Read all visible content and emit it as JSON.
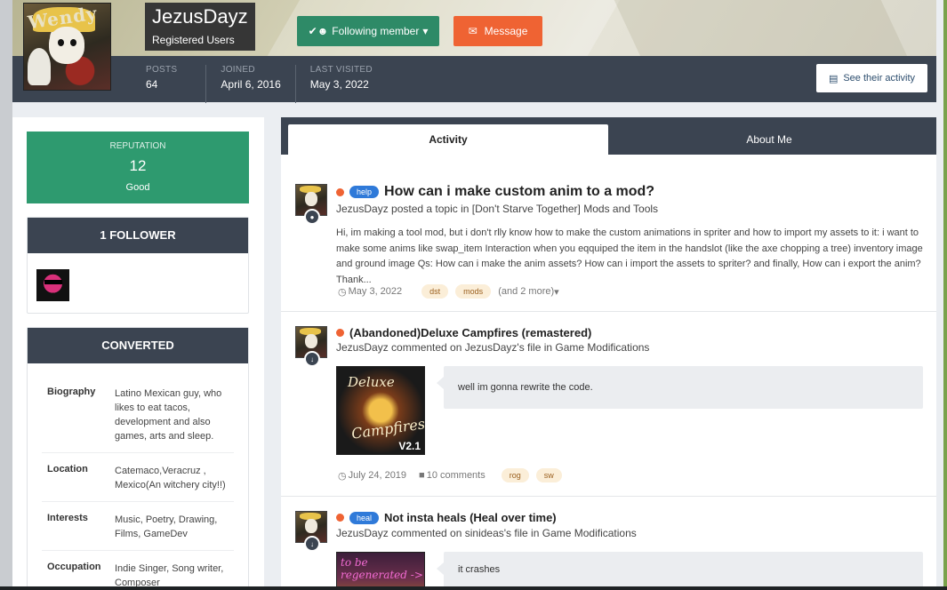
{
  "profile": {
    "avatar_text": "Wendy",
    "username": "JezusDayz",
    "group": "Registered Users",
    "follow_label": "Following member",
    "message_label": "Message",
    "activity_label": "See their activity",
    "stats": [
      {
        "label": "POSTS",
        "value": "64"
      },
      {
        "label": "JOINED",
        "value": "April 6, 2016"
      },
      {
        "label": "LAST VISITED",
        "value": "May 3, 2022"
      }
    ]
  },
  "sidebar": {
    "reputation": {
      "label": "REPUTATION",
      "value": "12",
      "text": "Good"
    },
    "followers_title": "1 FOLLOWER",
    "about_title": "CONVERTED",
    "about": [
      {
        "key": "Biography",
        "value": "Latino Mexican guy, who likes to eat tacos, development and also games, arts and sleep."
      },
      {
        "key": "Location",
        "value": "Catemaco,Veracruz , Mexico(An witchery city!!)"
      },
      {
        "key": "Interests",
        "value": "Music, Poetry, Drawing, Films, GameDev"
      },
      {
        "key": "Occupation",
        "value": "Indie Singer, Song writer, Composer"
      }
    ]
  },
  "tabs": {
    "activity": "Activity",
    "about": "About Me"
  },
  "feed": [
    {
      "badge": "help",
      "title": "How can i make custom anim to a mod?",
      "subtitle": "JezusDayz posted a topic in [Don't Starve Together] Mods and Tools",
      "body": "Hi, im making a tool mod, but i don't rlly know how to make the custom animations in spriter and how to import my assets to it: i want to make some anims like swap_item Interaction when you eqquiped the item in the handslot (like the axe chopping a tree) inventory image and ground image Qs: How can i make the anim assets? How can i import the assets to spriter? and finally, How can i export the anim? Thank...",
      "date": "May 3, 2022",
      "tags": [
        "dst",
        "mods"
      ],
      "more": "(and 2 more)"
    },
    {
      "title": "(Abandoned)Deluxe Campfires (remastered)",
      "subtitle": "JezusDayz commented on JezusDayz's file in Game Modifications",
      "image_text_1": "Deluxe",
      "image_text_2": "Campfires",
      "image_text_3": "V2.1",
      "comment": "well im gonna rewrite the code.",
      "date": "July 24, 2019",
      "comments": "10 comments",
      "tags": [
        "rog",
        "sw"
      ]
    },
    {
      "badge": "heal",
      "title": "Not insta heals (Heal over time)",
      "subtitle": "JezusDayz commented on sinideas's file in Game Modifications",
      "image_text": "to be regenerated ->",
      "comment": "it crashes"
    }
  ],
  "colors": {
    "follow_green": "#2e8a67",
    "message_orange": "#ef6333",
    "reputation_green": "#2e9a6f",
    "dark_header": "#3b4451",
    "badge_blue": "#2f7ad9"
  },
  "icons": {
    "follow": "check-user-icon",
    "message": "envelope-icon",
    "activity": "newspaper-icon",
    "topic": "speech-bubble-icon",
    "file": "download-icon",
    "clock": "clock-icon",
    "comment": "comment-icon"
  }
}
